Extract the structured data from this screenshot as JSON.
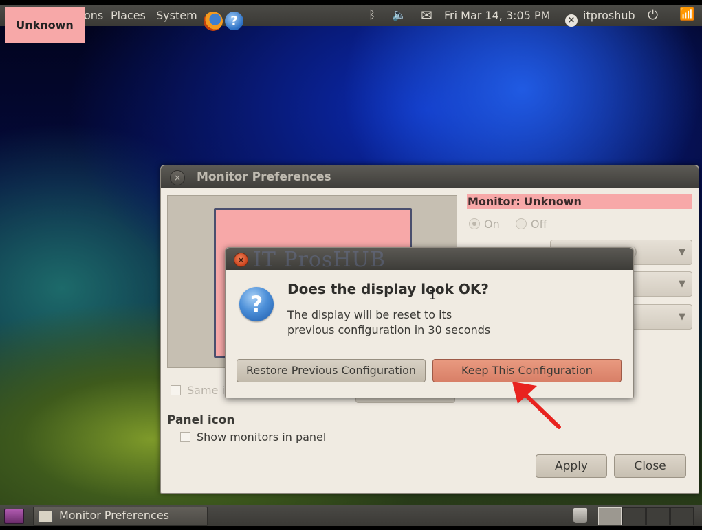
{
  "top_panel": {
    "menu_applications": "ons",
    "menu_places": "Places",
    "menu_system": "System",
    "clock": "Fri Mar 14,  3:05 PM",
    "username": "itproshub"
  },
  "overlay_label": "Unknown",
  "monitor_prefs": {
    "title": "Monitor Preferences",
    "monitor_header": "Monitor: Unknown",
    "radio_on": "On",
    "radio_off": "Off",
    "combo_resolution_partial": ")",
    "same_image_partial": "Same i",
    "panel_icon_heading": "Panel icon",
    "show_monitors_label": "Show monitors in panel",
    "apply_label": "Apply",
    "close_label": "Close"
  },
  "dialog": {
    "watermark": "IT ProsHUB",
    "heading": "Does the display look OK?",
    "body": "The display will be reset to its\nprevious configuration in 30 seconds",
    "restore_label": "Restore Previous Configuration",
    "keep_label": "Keep This Configuration"
  },
  "taskbar": {
    "task_label": "Monitor Preferences"
  },
  "colors": {
    "highlight_pink": "#f7a8a8",
    "keep_button": "#e08a72",
    "annotation_arrow": "#e8231f"
  }
}
